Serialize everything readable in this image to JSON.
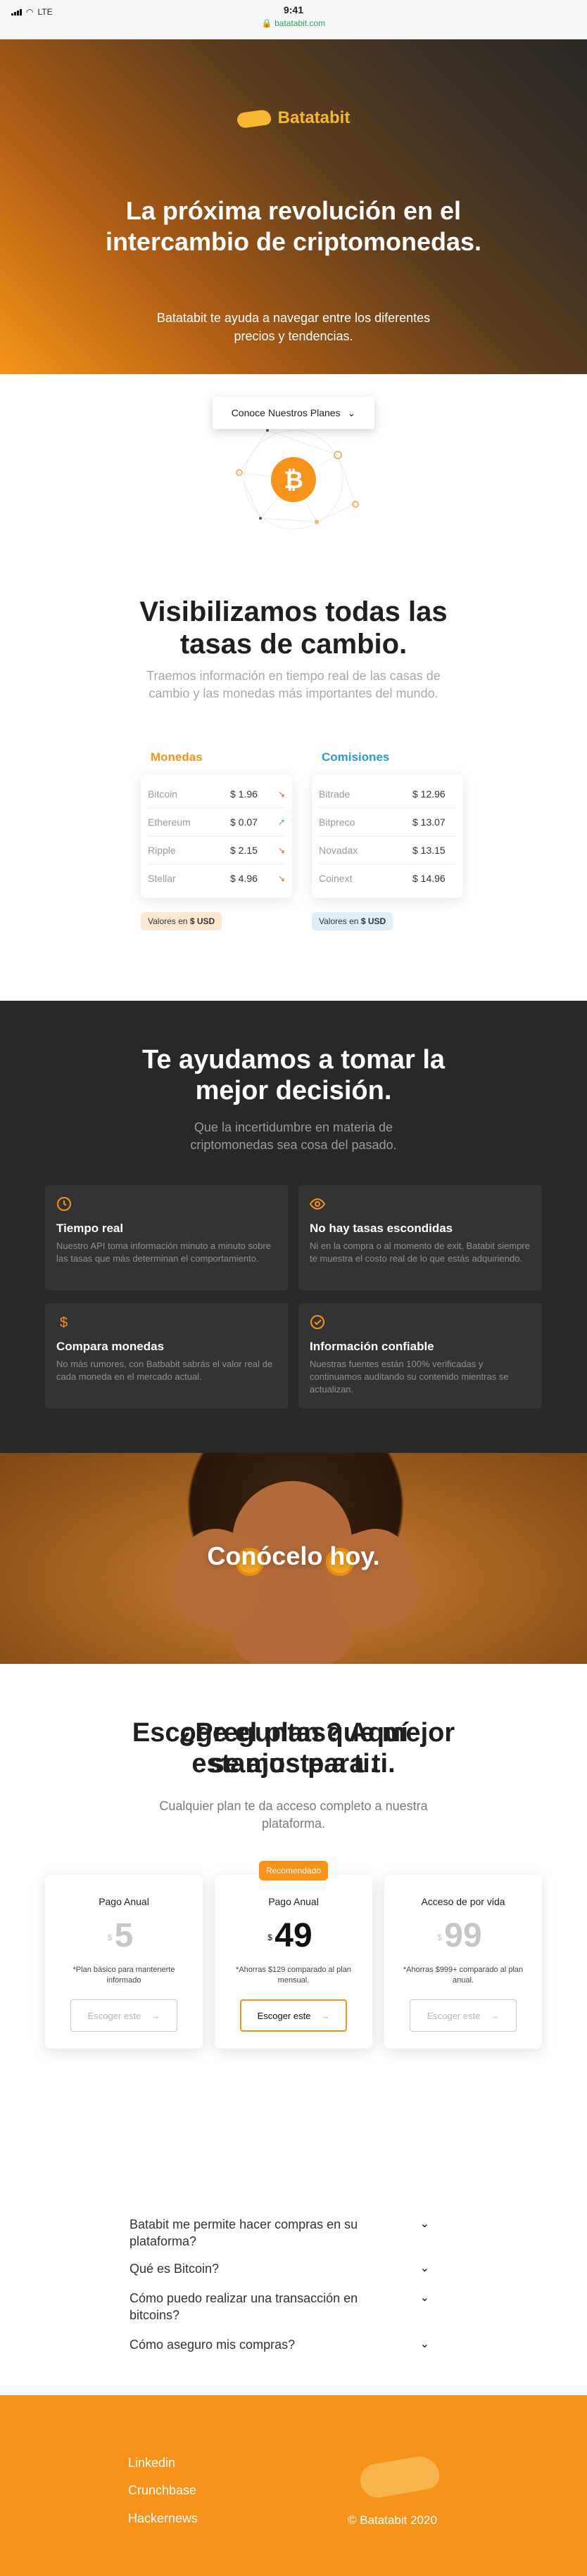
{
  "status": {
    "carrier": "LTE",
    "time": "9:41",
    "url": "batatabit.com"
  },
  "hero": {
    "brand": "Batatabit",
    "title": "La próxima revolución en el intercambio de criptomonedas.",
    "subtitle": "Batatabit te ayuda a navegar entre los diferentes precios y tendencias.",
    "cta": "Conoce Nuestros Planes"
  },
  "currency": {
    "title": "Visibilizamos todas las tasas de cambio.",
    "subtitle": "Traemos información en tiempo real de las casas de cambio y las monedas más importantes del mundo.",
    "coins": {
      "title": "Monedas",
      "rows": [
        {
          "name": "Bitcoin",
          "value": "$ 1.96",
          "trend": "down"
        },
        {
          "name": "Ethereum",
          "value": "$ 0.07",
          "trend": "up"
        },
        {
          "name": "Ripple",
          "value": "$ 2.15",
          "trend": "down"
        },
        {
          "name": "Stellar",
          "value": "$ 4.96",
          "trend": "down"
        }
      ],
      "badge_prefix": "Valores en",
      "badge_unit": "$ USD"
    },
    "exchanges": {
      "title": "Comisiones",
      "rows": [
        {
          "name": "Bitrade",
          "value": "$ 12.96"
        },
        {
          "name": "Bitpreco",
          "value": "$ 13.07"
        },
        {
          "name": "Novadax",
          "value": "$ 13.15"
        },
        {
          "name": "Coinext",
          "value": "$ 14.96"
        }
      ],
      "badge_prefix": "Valores en",
      "badge_unit": "$ USD"
    }
  },
  "features": {
    "title": "Te ayudamos a tomar la mejor decisión.",
    "subtitle": "Que la incertidumbre en materia de criptomonedas sea cosa del pasado.",
    "items": [
      {
        "icon": "clock-icon",
        "title": "Tiempo real",
        "text": "Nuestro API toma información minuto a minuto sobre las tasas que más determinan el comportamiento."
      },
      {
        "icon": "eye-icon",
        "title": "No hay tasas escondidas",
        "text": "Ni en la compra o al momento de exit, Batabit siempre te muestra el costo real de lo que estás adquiriendo."
      },
      {
        "icon": "dollar-icon",
        "title": "Compara monedas",
        "text": "No más rumores, con Batbabit sabrás el valor real de cada moneda en el mercado actual."
      },
      {
        "icon": "check-circle-icon",
        "title": "Información confiable",
        "text": "Nuestras fuentes están 100% verificadas y continuamos auditando su contenido mientras se actualizan."
      }
    ]
  },
  "banner": {
    "title": "Conócelo hoy."
  },
  "plans": {
    "title": "Escoge el plan que mejor se ajuste a ti.",
    "subtitle": "Cualquier plan te da acceso completo a nuestra plataforma.",
    "items": [
      {
        "name": "Pago Anual",
        "currency": "$",
        "price": "5",
        "note": "*Plan básico para mantenerte informado",
        "button": "Escoger este"
      },
      {
        "tag": "Recomendado",
        "name": "Pago Anual",
        "currency": "$",
        "price": "49",
        "note": "*Ahorras $129 comparado al plan mensual.",
        "button": "Escoger este"
      },
      {
        "name": "Acceso de por vida",
        "currency": "$",
        "price": "99",
        "note": "*Ahorras $999+ comparado al plan anual.",
        "button": "Escoger este"
      }
    ]
  },
  "faq": {
    "title": "¿Preguntas? Aquí estamos para ti.",
    "items": [
      "Batabit me permite hacer compras en su plataforma?",
      "Qué es Bitcoin?",
      "Cómo puedo realizar una transacción en bitcoins?",
      "Cómo aseguro mis compras?"
    ]
  },
  "footer": {
    "links": [
      "Linkedin",
      "Crunchbase",
      "Hackernews"
    ],
    "copyright": "© Batatabit 2020"
  },
  "colors": {
    "accent": "#f7931a",
    "dark": "#282828",
    "blue": "#2a9bd6"
  }
}
